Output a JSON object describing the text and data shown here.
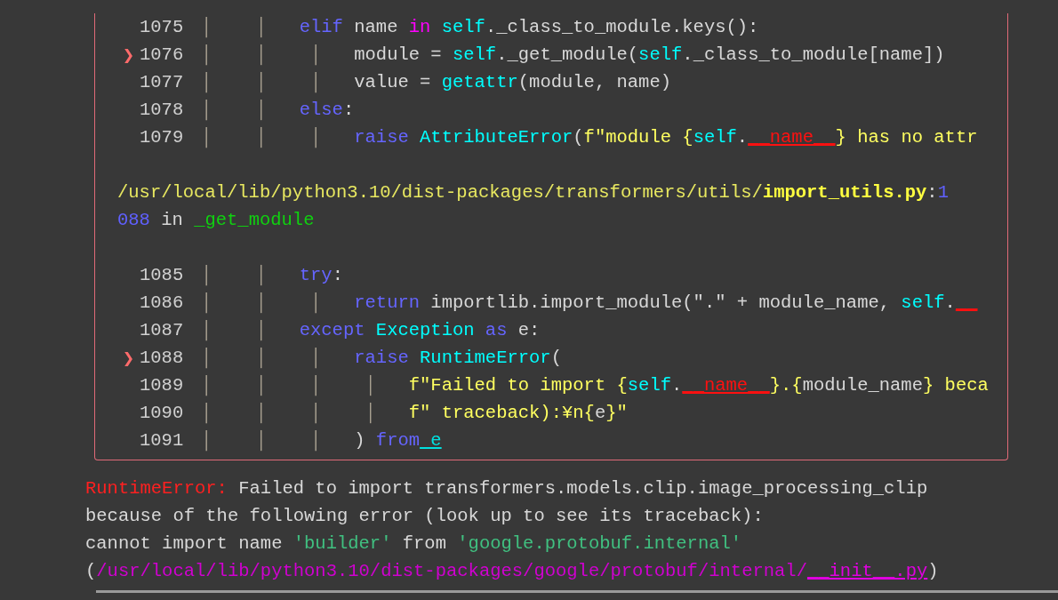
{
  "traceback": {
    "lines": [
      {
        "kind": "code",
        "number": "1075",
        "segments": [
          {
            "text": "│    │   ",
            "kind": "guide"
          },
          {
            "text": "elif",
            "kind": "keyword"
          },
          {
            "text": " name ",
            "kind": "plain"
          },
          {
            "text": "in",
            "kind": "operator"
          },
          {
            "text": " self",
            "kind": "builtin"
          },
          {
            "text": "._class_to_module.keys():",
            "kind": "plain"
          }
        ]
      },
      {
        "kind": "code",
        "number": "1076",
        "marker": "❯",
        "segments": [
          {
            "text": "│    │    │   ",
            "kind": "guide"
          },
          {
            "text": "module = ",
            "kind": "plain"
          },
          {
            "text": "self",
            "kind": "builtin"
          },
          {
            "text": "._get_module(",
            "kind": "plain"
          },
          {
            "text": "self",
            "kind": "builtin"
          },
          {
            "text": "._class_to_module[name])",
            "kind": "plain"
          }
        ]
      },
      {
        "kind": "code",
        "number": "1077",
        "segments": [
          {
            "text": "│    │    │   ",
            "kind": "guide"
          },
          {
            "text": "value = ",
            "kind": "plain"
          },
          {
            "text": "getattr",
            "kind": "builtin"
          },
          {
            "text": "(module, name)",
            "kind": "plain"
          }
        ]
      },
      {
        "kind": "code",
        "number": "1078",
        "segments": [
          {
            "text": "│    │   ",
            "kind": "guide"
          },
          {
            "text": "else",
            "kind": "keyword"
          },
          {
            "text": ":",
            "kind": "plain"
          }
        ]
      },
      {
        "kind": "code",
        "number": "1079",
        "segments": [
          {
            "text": "│    │    │   ",
            "kind": "guide"
          },
          {
            "text": "raise",
            "kind": "keyword"
          },
          {
            "text": " AttributeError",
            "kind": "builtin"
          },
          {
            "text": "(",
            "kind": "plain"
          },
          {
            "text": "f\"module {",
            "kind": "string"
          },
          {
            "text": "self",
            "kind": "builtin"
          },
          {
            "text": ".",
            "kind": "plain"
          },
          {
            "text": "__name__",
            "kind": "dunder"
          },
          {
            "text": "} has no attr",
            "kind": "string"
          }
        ]
      },
      {
        "kind": "blank"
      },
      {
        "kind": "location",
        "segments": [
          {
            "text": "/usr/local/lib/python3.10/dist-packages/transformers/utils/",
            "kind": "path"
          },
          {
            "text": "import_utils.py",
            "kind": "file"
          },
          {
            "text": ":",
            "kind": "plain"
          },
          {
            "text": "1",
            "kind": "number"
          }
        ]
      },
      {
        "kind": "location",
        "segments": [
          {
            "text": "088",
            "kind": "number"
          },
          {
            "text": " in ",
            "kind": "plain"
          },
          {
            "text": "_get_module",
            "kind": "function"
          }
        ]
      },
      {
        "kind": "blank"
      },
      {
        "kind": "code",
        "number": "1085",
        "segments": [
          {
            "text": "│    │   ",
            "kind": "guide"
          },
          {
            "text": "try",
            "kind": "keyword"
          },
          {
            "text": ":",
            "kind": "plain"
          }
        ]
      },
      {
        "kind": "code",
        "number": "1086",
        "segments": [
          {
            "text": "│    │    │   ",
            "kind": "guide"
          },
          {
            "text": "return",
            "kind": "keyword"
          },
          {
            "text": " importlib.import_module(\".\" + module_name, ",
            "kind": "plain"
          },
          {
            "text": "self",
            "kind": "builtin"
          },
          {
            "text": ".",
            "kind": "plain"
          },
          {
            "text": "__",
            "kind": "dunder"
          }
        ]
      },
      {
        "kind": "code",
        "number": "1087",
        "segments": [
          {
            "text": "│    │   ",
            "kind": "guide"
          },
          {
            "text": "except",
            "kind": "keyword"
          },
          {
            "text": " Exception",
            "kind": "builtin"
          },
          {
            "text": " as",
            "kind": "keyword"
          },
          {
            "text": " e:",
            "kind": "plain"
          }
        ]
      },
      {
        "kind": "code",
        "number": "1088",
        "marker": "❯",
        "segments": [
          {
            "text": "│    │    │   ",
            "kind": "guide"
          },
          {
            "text": "raise",
            "kind": "keyword"
          },
          {
            "text": " RuntimeError",
            "kind": "builtin"
          },
          {
            "text": "(",
            "kind": "plain"
          }
        ]
      },
      {
        "kind": "code",
        "number": "1089",
        "segments": [
          {
            "text": "│    │    │    │   ",
            "kind": "guide"
          },
          {
            "text": "f\"Failed to import {",
            "kind": "string"
          },
          {
            "text": "self",
            "kind": "builtin"
          },
          {
            "text": ".",
            "kind": "plain"
          },
          {
            "text": "__name__",
            "kind": "dunder"
          },
          {
            "text": "}.{",
            "kind": "string"
          },
          {
            "text": "module_name",
            "kind": "plain"
          },
          {
            "text": "} beca",
            "kind": "string"
          }
        ]
      },
      {
        "kind": "code",
        "number": "1090",
        "segments": [
          {
            "text": "│    │    │    │   ",
            "kind": "guide"
          },
          {
            "text": "f\" traceback):¥n{",
            "kind": "string"
          },
          {
            "text": "e",
            "kind": "plain"
          },
          {
            "text": "}\"",
            "kind": "string"
          }
        ]
      },
      {
        "kind": "code",
        "number": "1091",
        "segments": [
          {
            "text": "│    │    │   ",
            "kind": "guide"
          },
          {
            "text": ") ",
            "kind": "plain"
          },
          {
            "text": "from",
            "kind": "keyword"
          },
          {
            "text": " e",
            "kind": "reference"
          }
        ]
      }
    ]
  },
  "error": {
    "lines": [
      {
        "segments": [
          {
            "text": "RuntimeError:",
            "kind": "error"
          },
          {
            "text": " Failed to import transformers.models.clip.image_processing_clip",
            "kind": "plain"
          }
        ]
      },
      {
        "segments": [
          {
            "text": "because of the following error (look up to see its traceback):",
            "kind": "plain"
          }
        ]
      },
      {
        "segments": [
          {
            "text": "cannot import name ",
            "kind": "plain"
          },
          {
            "text": "'builder'",
            "kind": "quoted"
          },
          {
            "text": " from ",
            "kind": "plain"
          },
          {
            "text": "'google.protobuf.internal'",
            "kind": "quoted"
          }
        ]
      },
      {
        "segments": [
          {
            "text": "(",
            "kind": "plain"
          },
          {
            "text": "/usr/local/lib/python3.10/dist-packages/google/protobuf/internal/",
            "kind": "errpath"
          },
          {
            "text": "__init__.py",
            "kind": "errfile"
          },
          {
            "text": ")",
            "kind": "plain"
          }
        ]
      }
    ]
  }
}
